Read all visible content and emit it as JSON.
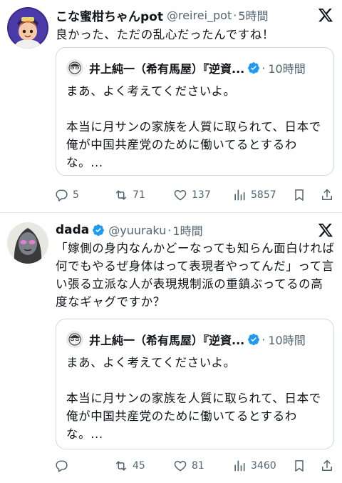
{
  "tweets": [
    {
      "author_name": "こな蜜柑ちゃんpot",
      "handle": "@reirei_pot",
      "time": "5時間",
      "text": "良かった、ただの乱心だったんですね！",
      "quote": {
        "author_name": "井上純一（希有馬屋）『逆資...",
        "time": "10時間",
        "text": "まあ、よく考えてくださいよ。\n\n本当に月サンの家族を人質に取られて、日本で俺が中国共産党のために働いてるとするわな。..."
      },
      "actions": {
        "replies": "5",
        "retweets": "71",
        "likes": "137",
        "views": "5857"
      }
    },
    {
      "author_name": "dada",
      "handle": "@yuuraku",
      "time": "1時間",
      "text": "「嫁側の身内なんかどーなっても知らん面白ければ何でもやるぜ身体はって表現者やってんだ」って言い張る立派な人が表現規制派の重鎮ぶってるの高度なギャグですか？",
      "quote": {
        "author_name": "井上純一（希有馬屋）『逆資...",
        "time": "10時間",
        "text": "まあ、よく考えてくださいよ。\n\n本当に月サンの家族を人質に取られて、日本で俺が中国共産党のために働いてるとするわな。..."
      },
      "actions": {
        "replies": "",
        "retweets": "45",
        "likes": "81",
        "views": "3460"
      }
    }
  ],
  "separator": "·",
  "colors": {
    "verified": "#1d9bf0",
    "text": "#0f1419",
    "secondary": "#536471",
    "border": "#cfd9de"
  },
  "icons": [
    "x-logo-icon",
    "verified-badge-icon",
    "reply-icon",
    "retweet-icon",
    "like-icon",
    "views-icon",
    "bookmark-icon",
    "share-icon"
  ]
}
